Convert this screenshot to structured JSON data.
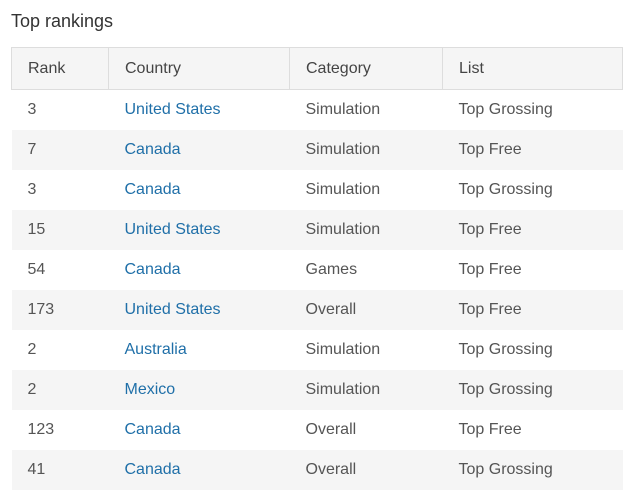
{
  "title": "Top rankings",
  "columns": [
    "Rank",
    "Country",
    "Category",
    "List"
  ],
  "rows": [
    {
      "rank": "3",
      "country": "United States",
      "category": "Simulation",
      "list": "Top Grossing"
    },
    {
      "rank": "7",
      "country": "Canada",
      "category": "Simulation",
      "list": "Top Free"
    },
    {
      "rank": "3",
      "country": "Canada",
      "category": "Simulation",
      "list": "Top Grossing"
    },
    {
      "rank": "15",
      "country": "United States",
      "category": "Simulation",
      "list": "Top Free"
    },
    {
      "rank": "54",
      "country": "Canada",
      "category": "Games",
      "list": "Top Free"
    },
    {
      "rank": "173",
      "country": "United States",
      "category": "Overall",
      "list": "Top Free"
    },
    {
      "rank": "2",
      "country": "Australia",
      "category": "Simulation",
      "list": "Top Grossing"
    },
    {
      "rank": "2",
      "country": "Mexico",
      "category": "Simulation",
      "list": "Top Grossing"
    },
    {
      "rank": "123",
      "country": "Canada",
      "category": "Overall",
      "list": "Top Free"
    },
    {
      "rank": "41",
      "country": "Canada",
      "category": "Overall",
      "list": "Top Grossing"
    }
  ],
  "colors": {
    "link": "#1f6fa8",
    "header_bg": "#f5f5f5",
    "stripe_bg": "#f5f5f5",
    "border": "#dddddd"
  }
}
